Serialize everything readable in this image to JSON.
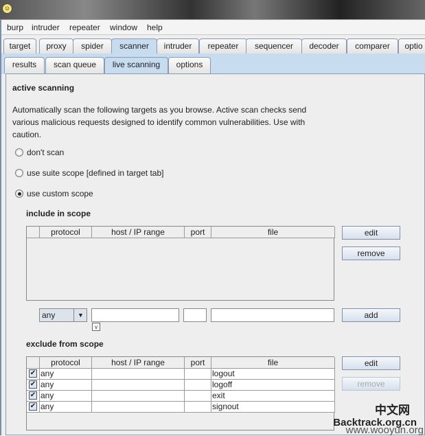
{
  "menu": [
    "burp",
    "intruder",
    "repeater",
    "window",
    "help"
  ],
  "tabs": [
    "target",
    "proxy",
    "spider",
    "scanner",
    "intruder",
    "repeater",
    "sequencer",
    "decoder",
    "comparer",
    "optio"
  ],
  "active_tab": "scanner",
  "subtabs": [
    "results",
    "scan queue",
    "live scanning",
    "options"
  ],
  "active_subtab": "live scanning",
  "section_title": "active scanning",
  "description": [
    "Automatically scan the following targets as you browse. Active scan checks send",
    "various malicious requests designed to identify common vulnerabilities. Use with",
    "caution."
  ],
  "radios": [
    {
      "label": "don't scan",
      "checked": false
    },
    {
      "label": "use suite scope [defined in target tab]",
      "checked": false
    },
    {
      "label": "use custom scope",
      "checked": true
    }
  ],
  "include": {
    "title": "include in scope",
    "columns": [
      "",
      "protocol",
      "host / IP range",
      "port",
      "file"
    ],
    "rows": [],
    "edit": "edit",
    "remove": "remove"
  },
  "add_row": {
    "protocol": "any",
    "host": "",
    "port": "",
    "file": "",
    "add": "add"
  },
  "exclude": {
    "title": "exclude from scope",
    "columns": [
      "",
      "protocol",
      "host / IP range",
      "port",
      "file"
    ],
    "rows": [
      {
        "enabled": true,
        "protocol": "any",
        "host": "",
        "port": "",
        "file": "logout"
      },
      {
        "enabled": true,
        "protocol": "any",
        "host": "",
        "port": "",
        "file": "logoff"
      },
      {
        "enabled": true,
        "protocol": "any",
        "host": "",
        "port": "",
        "file": "exit"
      },
      {
        "enabled": true,
        "protocol": "any",
        "host": "",
        "port": "",
        "file": "signout"
      }
    ],
    "edit": "edit",
    "remove": "remove",
    "remove_disabled": true
  },
  "watermark": [
    "中文网",
    "Backtrack.org.cn",
    "www.wooyun.org"
  ],
  "colors": {
    "tab_selected": "#c8dcf0",
    "panel": "#eeeeee"
  }
}
